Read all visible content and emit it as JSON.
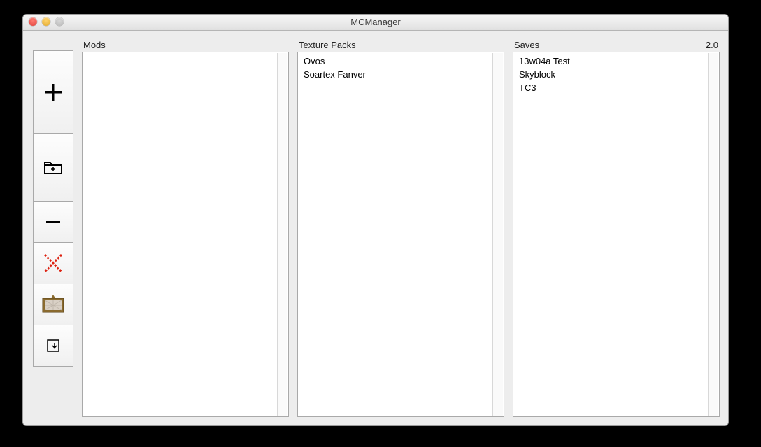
{
  "window": {
    "title": "MCManager"
  },
  "version_label": "2.0",
  "columns": {
    "mods": {
      "header": "Mods",
      "items": []
    },
    "tex": {
      "header": "Texture Packs",
      "items": [
        "Ovos",
        "Soartex Fanver"
      ]
    },
    "saves": {
      "header": "Saves",
      "items": [
        "13w04a Test",
        "Skyblock",
        "TC3"
      ]
    }
  },
  "sidebar": {
    "add": {
      "label": "Add"
    },
    "add_folder": {
      "label": "Add Folder"
    },
    "remove": {
      "label": "Remove"
    },
    "delete": {
      "label": "Delete"
    },
    "painting": {
      "label": "Painting"
    },
    "export": {
      "label": "Export"
    }
  }
}
